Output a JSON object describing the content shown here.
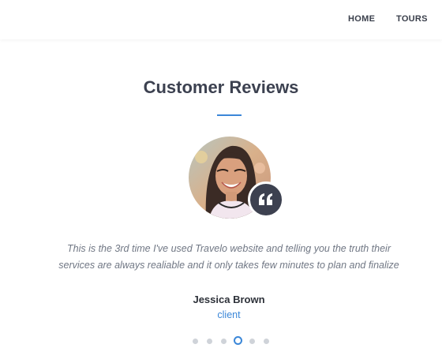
{
  "nav": {
    "home_label": "HOME",
    "tours_label": "TOURS"
  },
  "reviews": {
    "title": "Customer Reviews",
    "quote_text": "This is the 3rd time I've used Travelo website and telling you the truth their services are always realiable and it only takes few minutes to plan and finalize",
    "reviewer_name": "Jessica Brown",
    "reviewer_role": "client",
    "quote_icon": "quote-icon",
    "accent_color": "#3b87d8",
    "carousel": {
      "total_slides": 6,
      "active_slide": 4
    }
  }
}
